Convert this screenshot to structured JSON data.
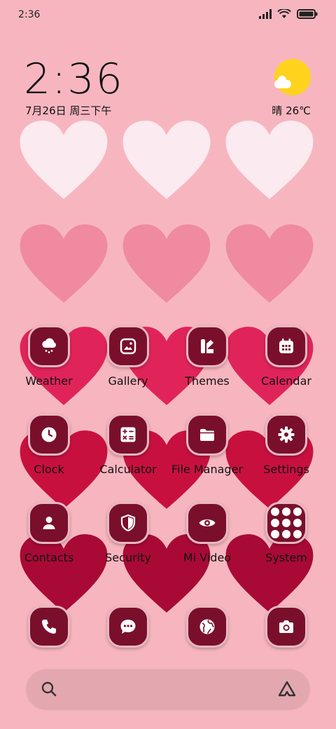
{
  "status_bar": {
    "time": "2:36",
    "icons": [
      "signal-icon",
      "wifi-icon",
      "battery-icon"
    ]
  },
  "clock_widget": {
    "time": "2:36",
    "date": "7月26日 周三下午"
  },
  "weather_widget": {
    "condition_icon": "sun-cloud-icon",
    "text": "晴 26℃"
  },
  "apps": {
    "row1": [
      {
        "label": "Weather",
        "icon": "cloud-rain-icon"
      },
      {
        "label": "Gallery",
        "icon": "image-icon"
      },
      {
        "label": "Themes",
        "icon": "brush-icon"
      },
      {
        "label": "Calendar",
        "icon": "calendar-icon"
      }
    ],
    "row2": [
      {
        "label": "Clock",
        "icon": "clock-icon"
      },
      {
        "label": "Calculator",
        "icon": "calculator-icon"
      },
      {
        "label": "File Manager",
        "icon": "folder-icon"
      },
      {
        "label": "Settings",
        "icon": "gear-icon"
      }
    ],
    "row3": [
      {
        "label": "Contacts",
        "icon": "person-icon"
      },
      {
        "label": "Security",
        "icon": "shield-icon"
      },
      {
        "label": "Mi Video",
        "icon": "eye-icon"
      },
      {
        "label": "System",
        "icon": "folder-grid-icon"
      }
    ]
  },
  "dock": [
    {
      "icon": "phone-icon"
    },
    {
      "icon": "message-icon"
    },
    {
      "icon": "globe-icon"
    },
    {
      "icon": "camera-icon"
    }
  ],
  "search_bar": {
    "left_icon": "search-icon",
    "right_icon": "assistant-icon"
  },
  "colors": {
    "background": "#f7b6bf",
    "icon_tile": "#7a0f2c",
    "icon_border": "#e9b6c0",
    "sun": "#ffd21e"
  }
}
